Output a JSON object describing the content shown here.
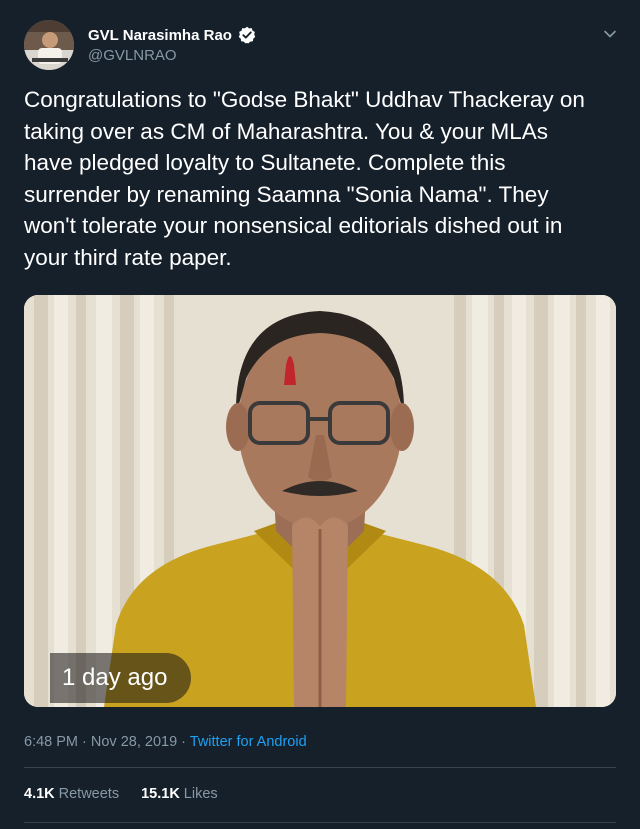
{
  "author": {
    "display_name": "GVL Narasimha Rao",
    "handle": "@GVLNRAO",
    "verified": true,
    "avatar_icon": "profile-photo"
  },
  "tweet": {
    "text": "Congratulations to \"Godse Bhakt\" Uddhav Thackeray on\ntaking over as CM of Maharashtra. You & your MLAs\nhave pledged loyalty to Sultanete. Complete this\nsurrender by renaming Saamna \"Sonia Nama\". They\nwon't tolerate your nonsensical editorials dished out in\nyour third rate paper."
  },
  "media": {
    "overlay_label": "1 day ago"
  },
  "meta": {
    "time": "6:48 PM",
    "separator": " · ",
    "date": "Nov 28, 2019",
    "separator2": " · ",
    "source": "Twitter for Android"
  },
  "stats": {
    "retweets_count": "4.1K",
    "retweets_label": "Retweets",
    "likes_count": "15.1K",
    "likes_label": "Likes"
  },
  "colors": {
    "background": "#15202b",
    "secondary_text": "#8899a6",
    "accent": "#1da1f2",
    "divider": "#38444d"
  }
}
